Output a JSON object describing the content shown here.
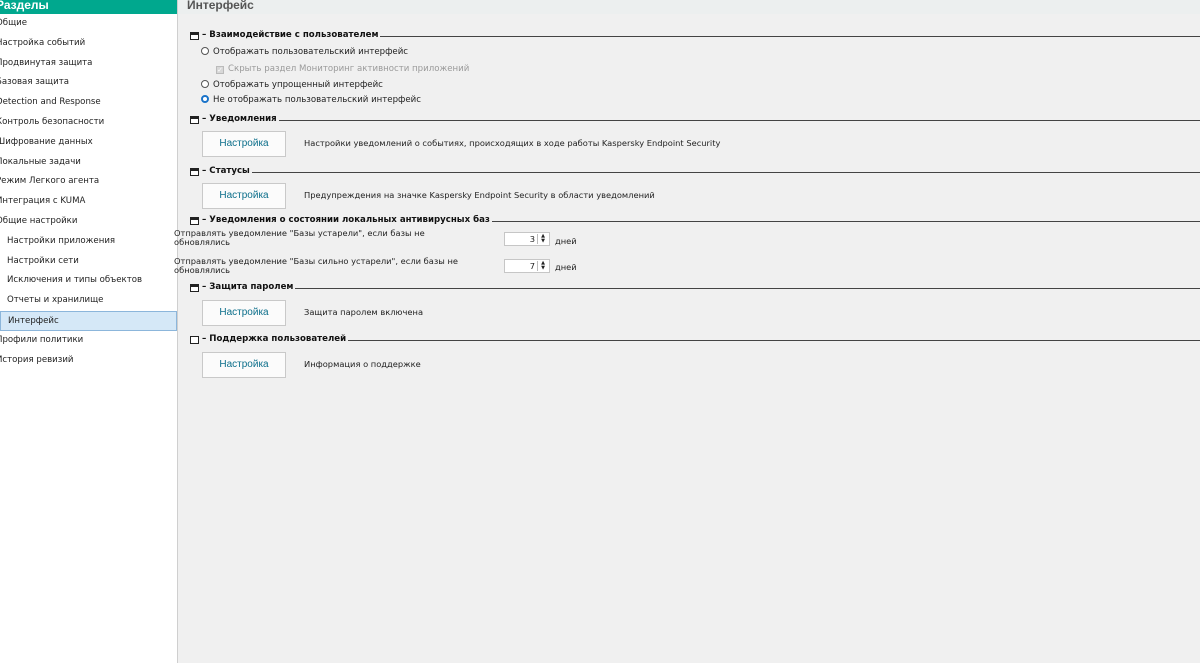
{
  "sidebar": {
    "title": "Разделы",
    "items": [
      {
        "label": "Общие",
        "child": false,
        "selected": false
      },
      {
        "label": "Настройка событий",
        "child": false,
        "selected": false
      },
      {
        "label": "Продвинутая защита",
        "child": false,
        "selected": false
      },
      {
        "label": "Базовая защита",
        "child": false,
        "selected": false
      },
      {
        "label": "Detection and Response",
        "child": false,
        "selected": false
      },
      {
        "label": "Контроль безопасности",
        "child": false,
        "selected": false
      },
      {
        "label": "Шифрование данных",
        "child": false,
        "selected": false
      },
      {
        "label": "Локальные задачи",
        "child": false,
        "selected": false
      },
      {
        "label": "Режим Легкого агента",
        "child": false,
        "selected": false
      },
      {
        "label": "Интеграция с KUMA",
        "child": false,
        "selected": false
      },
      {
        "label": "Общие настройки",
        "child": false,
        "selected": false
      },
      {
        "label": "Настройки приложения",
        "child": true,
        "selected": false
      },
      {
        "label": "Настройки сети",
        "child": true,
        "selected": false
      },
      {
        "label": "Исключения и типы объектов",
        "child": true,
        "selected": false
      },
      {
        "label": "Отчеты и хранилище",
        "child": true,
        "selected": false
      },
      {
        "label": "Интерфейс",
        "child": true,
        "selected": true
      },
      {
        "label": "Профили политики",
        "child": false,
        "selected": false
      },
      {
        "label": "История ревизий",
        "child": false,
        "selected": false
      }
    ]
  },
  "main": {
    "title": "Интерфейс",
    "interaction": {
      "title": "Взаимодействие с пользователем",
      "option_full": "Отображать пользовательский интерфейс",
      "option_hide_monitor": "Скрыть раздел Мониторинг активности приложений",
      "option_simple": "Отображать упрощенный интерфейс",
      "option_none": "Не отображать пользовательский интерфейс",
      "selected": "option_none"
    },
    "notifications": {
      "title": "Уведомления",
      "button": "Настройка",
      "description": "Настройки уведомлений о событиях, происходящих в ходе работы Kaspersky Endpoint Security"
    },
    "statuses": {
      "title": "Статусы",
      "button": "Настройка",
      "description": "Предупреждения на значке Kaspersky Endpoint Security в области уведомлений"
    },
    "av_bases": {
      "title": "Уведомления о состоянии локальных антивирусных баз",
      "outdated_label": "Отправлять уведомление \"Базы устарели\", если базы не обновлялись",
      "outdated_value": "3",
      "very_outdated_label": "Отправлять уведомление \"Базы сильно устарели\", если базы не обновлялись",
      "very_outdated_value": "7",
      "unit": "дней"
    },
    "password": {
      "title": "Защита паролем",
      "button": "Настройка",
      "description": "Защита паролем включена"
    },
    "support": {
      "title": "Поддержка пользователей",
      "button": "Настройка",
      "description": "Информация о поддержке"
    }
  }
}
